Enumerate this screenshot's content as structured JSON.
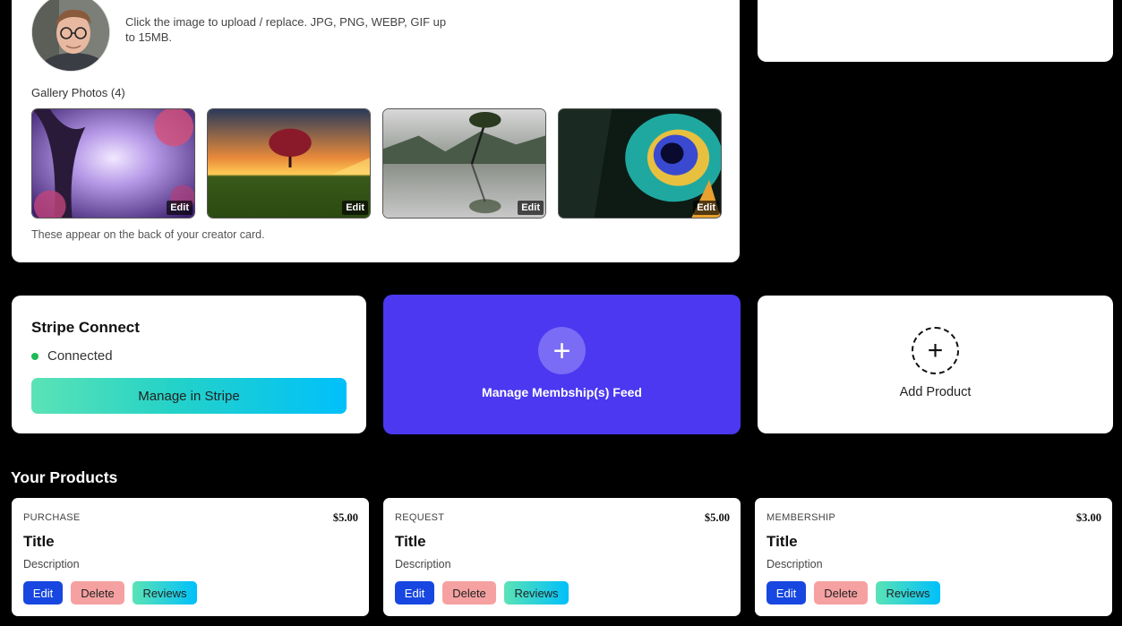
{
  "profile": {
    "upload_hint": "Click the image to upload / replace. JPG, PNG, WEBP, GIF up to 15MB.",
    "gallery_title": "Gallery Photos (4)",
    "gallery": [
      {
        "edit_label": "Edit"
      },
      {
        "edit_label": "Edit"
      },
      {
        "edit_label": "Edit"
      },
      {
        "edit_label": "Edit"
      }
    ],
    "gallery_note": "These appear on the back of your creator card."
  },
  "stripe": {
    "title": "Stripe Connect",
    "status": "Connected",
    "status_color": "#1db954",
    "button_label": "Manage in Stripe"
  },
  "membership": {
    "label": "Manage Membship(s) Feed",
    "accent": "#4b38f0",
    "icon": "plus-icon"
  },
  "add_product": {
    "label": "Add Product",
    "icon": "plus-circle-dashed-icon"
  },
  "products": {
    "section_title": "Your Products",
    "items": [
      {
        "type": "PURCHASE",
        "price": "$5.00",
        "title": "Title",
        "description": "Description",
        "edit": "Edit",
        "delete": "Delete",
        "reviews": "Reviews"
      },
      {
        "type": "REQUEST",
        "price": "$5.00",
        "title": "Title",
        "description": "Description",
        "edit": "Edit",
        "delete": "Delete",
        "reviews": "Reviews"
      },
      {
        "type": "MEMBERSHIP",
        "price": "$3.00",
        "title": "Title",
        "description": "Description",
        "edit": "Edit",
        "delete": "Delete",
        "reviews": "Reviews"
      }
    ]
  }
}
